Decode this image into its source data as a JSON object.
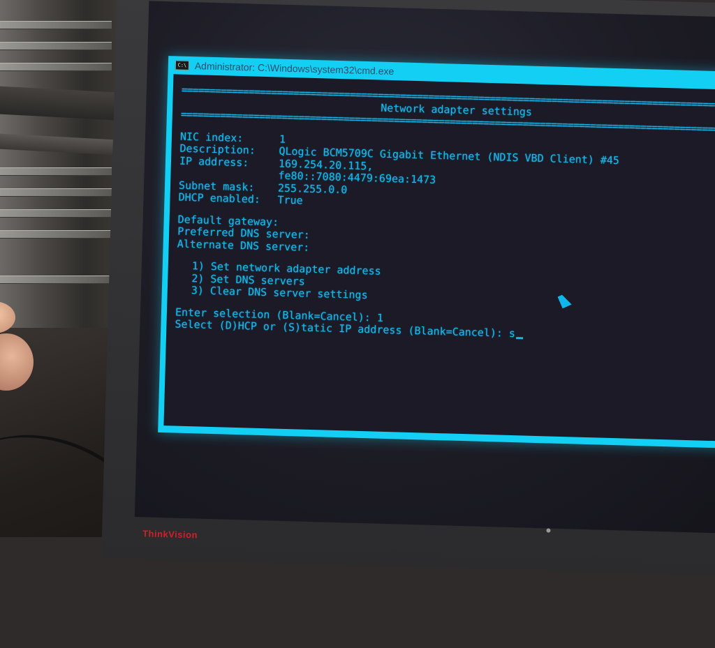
{
  "window": {
    "title": "Administrator: C:\\Windows\\system32\\cmd.exe",
    "icon": "cmd-window-icon"
  },
  "console": {
    "rule": "=========================================================================================================",
    "heading": "Network adapter settings",
    "fields": [
      {
        "label": "NIC index:",
        "value": "1"
      },
      {
        "label": "Description:",
        "value": "QLogic BCM5709C Gigabit Ethernet (NDIS VBD Client) #45"
      },
      {
        "label": "IP address:",
        "value": "169.254.20.115,\nfe80::7080:4479:69ea:1473"
      },
      {
        "label": "Subnet mask:",
        "value": "255.255.0.0"
      },
      {
        "label": "DHCP enabled:",
        "value": "True"
      }
    ],
    "dns_fields": [
      {
        "label": "Default gateway:",
        "value": ""
      },
      {
        "label": "Preferred DNS server:",
        "value": ""
      },
      {
        "label": "Alternate DNS server:",
        "value": ""
      }
    ],
    "menu": [
      "1) Set network adapter address",
      "2) Set DNS servers",
      "3) Clear DNS server settings"
    ],
    "prompt_selection": "Enter selection (Blank=Cancel): 1",
    "prompt_ip_type": "Select (D)HCP or (S)tatic IP address (Blank=Cancel): s"
  },
  "monitor": {
    "brand": "ThinkVision"
  },
  "colors": {
    "window_frame": "#12cff3",
    "console_bg": "#1b1a26",
    "console_text": "#19b8ec",
    "brand_red": "#d0202a"
  }
}
